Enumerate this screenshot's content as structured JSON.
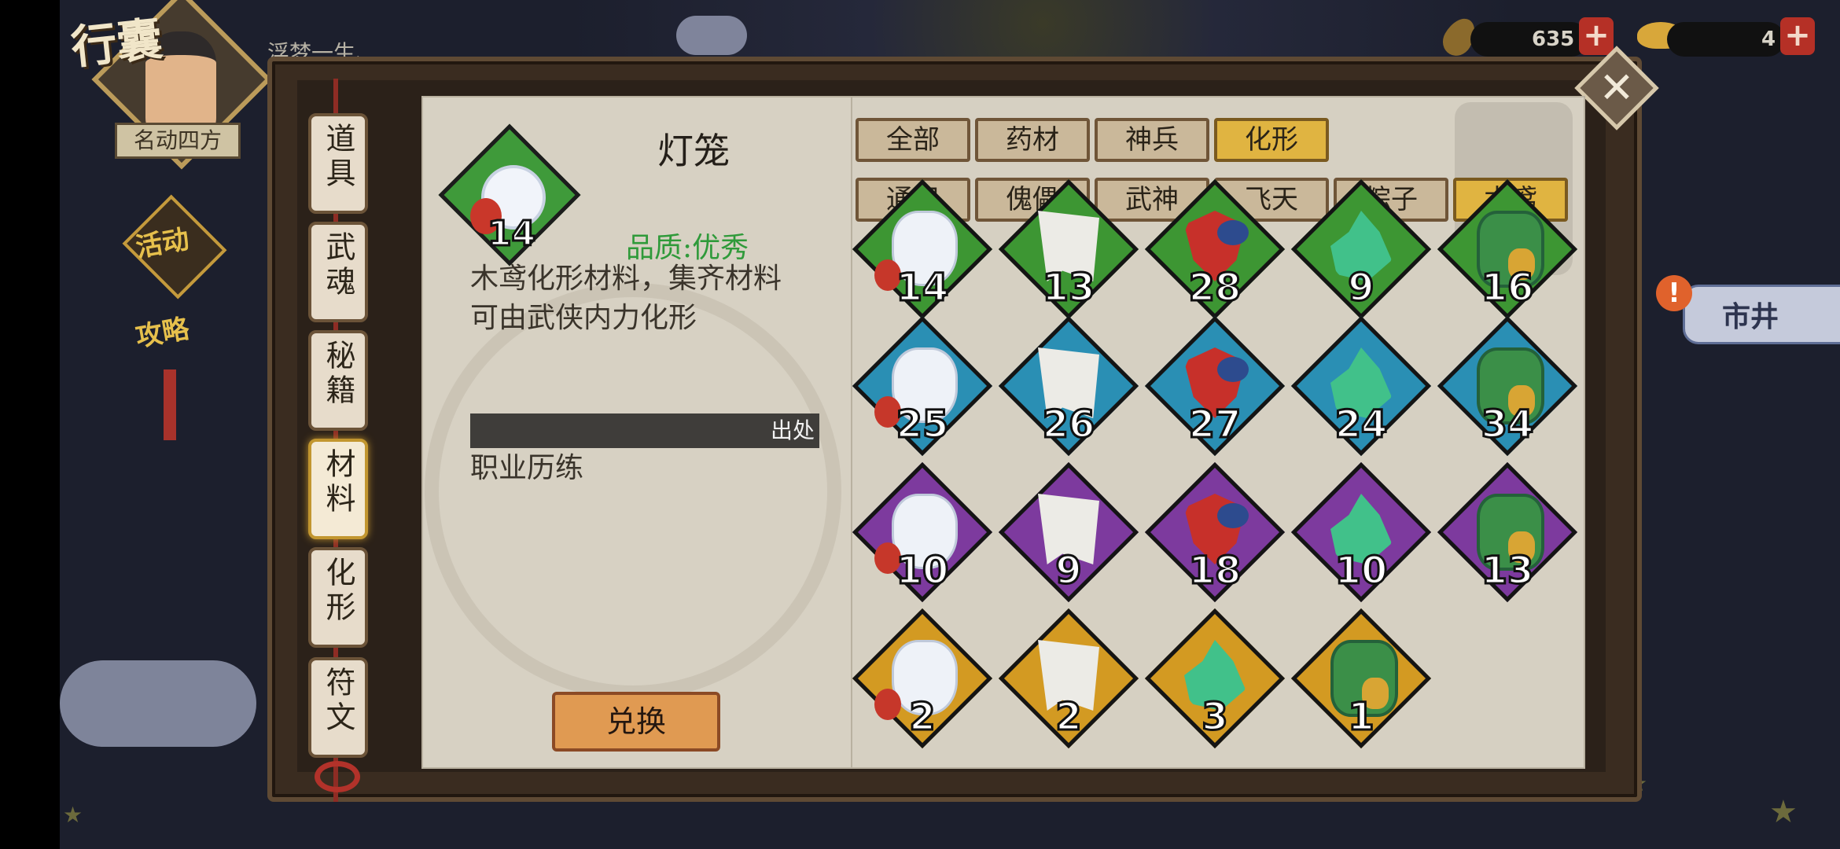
{
  "header": {
    "title": "行囊",
    "player_title": "名动四方",
    "scroll_text": "浮梦一生、",
    "side_badge_1": "活动",
    "side_badge_2": "攻略"
  },
  "currency": {
    "leaf_value": "635",
    "ingot_value": "4",
    "plus_label": "+"
  },
  "market": {
    "label": "市井",
    "alert": "!"
  },
  "close_label": "✕",
  "tabs": [
    {
      "label": "道具",
      "active": false
    },
    {
      "label": "武魂",
      "active": false
    },
    {
      "label": "秘籍",
      "active": false
    },
    {
      "label": "材料",
      "active": true
    },
    {
      "label": "化形",
      "active": false
    },
    {
      "label": "符文",
      "active": false
    }
  ],
  "detail": {
    "name": "灯笼",
    "count": "14",
    "quality": "品质:优秀",
    "description": "木鸢化形材料，集齐材料可由武侠内力化形",
    "source_label": "出处",
    "source_text": "职业历练",
    "exchange_button": "兑换"
  },
  "filters_row1": [
    {
      "label": "全部",
      "active": false
    },
    {
      "label": "药材",
      "active": false
    },
    {
      "label": "神兵",
      "active": false
    },
    {
      "label": "化形",
      "active": true
    }
  ],
  "filters_row2": [
    {
      "label": "通用",
      "active": false
    },
    {
      "label": "傀儡",
      "active": false
    },
    {
      "label": "武神",
      "active": false
    },
    {
      "label": "飞天",
      "active": false
    },
    {
      "label": "粽子",
      "active": false
    },
    {
      "label": "木鸢",
      "active": true
    }
  ],
  "items": [
    {
      "art": "lantern",
      "rarity": "green",
      "count": "14"
    },
    {
      "art": "cloth",
      "rarity": "green",
      "count": "13"
    },
    {
      "art": "kite",
      "rarity": "green",
      "count": "28"
    },
    {
      "art": "flame",
      "rarity": "green",
      "count": "9"
    },
    {
      "art": "drum",
      "rarity": "green",
      "count": "16"
    },
    {
      "art": "lantern",
      "rarity": "blue",
      "count": "25"
    },
    {
      "art": "cloth",
      "rarity": "blue",
      "count": "26"
    },
    {
      "art": "kite",
      "rarity": "blue",
      "count": "27"
    },
    {
      "art": "flame",
      "rarity": "blue",
      "count": "24"
    },
    {
      "art": "drum",
      "rarity": "blue",
      "count": "34"
    },
    {
      "art": "lantern",
      "rarity": "purple",
      "count": "10"
    },
    {
      "art": "cloth",
      "rarity": "purple",
      "count": "9"
    },
    {
      "art": "kite",
      "rarity": "purple",
      "count": "18"
    },
    {
      "art": "flame",
      "rarity": "purple",
      "count": "10"
    },
    {
      "art": "drum",
      "rarity": "purple",
      "count": "13"
    },
    {
      "art": "lantern",
      "rarity": "gold",
      "count": "2"
    },
    {
      "art": "cloth",
      "rarity": "gold",
      "count": "2"
    },
    {
      "art": "flame",
      "rarity": "gold",
      "count": "3"
    },
    {
      "art": "drum",
      "rarity": "gold",
      "count": "1"
    }
  ]
}
